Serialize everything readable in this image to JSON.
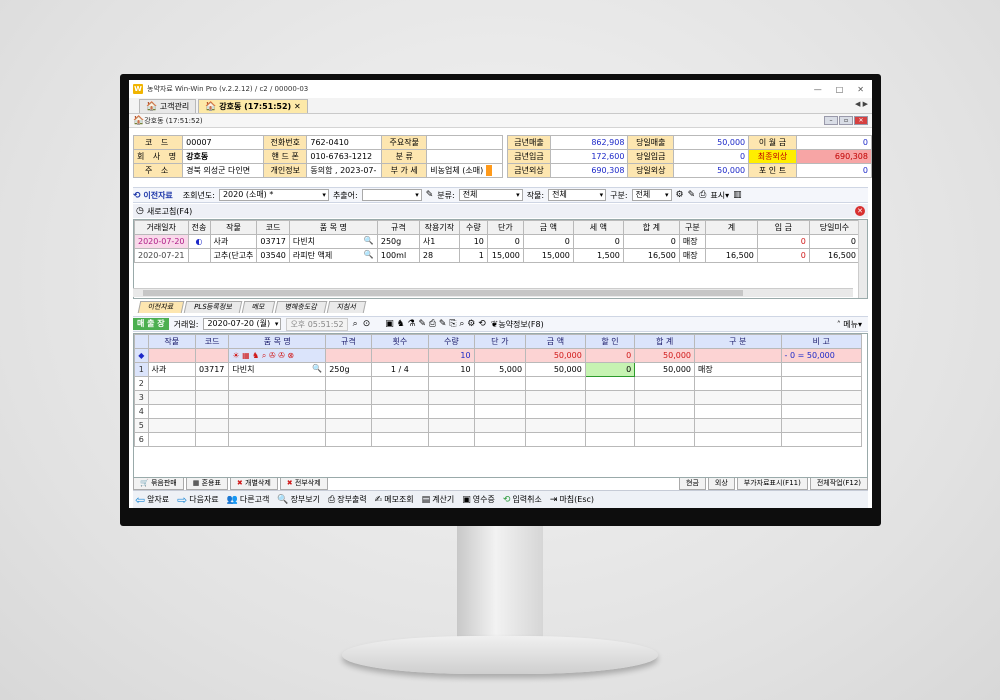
{
  "window": {
    "title": "농약자료 Win-Win Pro (v.2.2.12) / c2 / 00000-03",
    "logo": "W",
    "controls": [
      "—",
      "□",
      "✕"
    ]
  },
  "tabs": [
    {
      "label": "고객관리",
      "icon": "home-icon"
    },
    {
      "label": "강호동 (17:51:52)",
      "icon": "home-icon",
      "active": true
    }
  ],
  "subbar": {
    "title": "강호동 (17:51:52)"
  },
  "customer": {
    "rows": [
      [
        {
          "l": "코 드",
          "v": "00007"
        },
        {
          "l": "전화번호",
          "v": "762-0410"
        },
        {
          "l": "주요작물",
          "v": ""
        }
      ],
      [
        {
          "l": "회 사 명",
          "v": "강호동"
        },
        {
          "l": "핸 드 폰",
          "v": "010-6763-1212"
        },
        {
          "l": "분 류",
          "v": ""
        }
      ],
      [
        {
          "l": "주 소",
          "v": "경북 의성군 다인면"
        },
        {
          "l": "개인정보",
          "v": "동의함 , 2023-07-"
        },
        {
          "l": "부 가 세",
          "v": "비농업체 (소매)"
        }
      ]
    ]
  },
  "summary": {
    "rows": [
      [
        {
          "l": "금년매출",
          "v": "862,908"
        },
        {
          "l": "당일매출",
          "v": "50,000"
        },
        {
          "l": "이 월 금",
          "v": "0"
        }
      ],
      [
        {
          "l": "금년입금",
          "v": "172,600"
        },
        {
          "l": "당일입금",
          "v": "0"
        },
        {
          "l": "최종외상",
          "v": "690,308",
          "hot": true
        }
      ],
      [
        {
          "l": "금년외상",
          "v": "690,308"
        },
        {
          "l": "당일외상",
          "v": "50,000"
        },
        {
          "l": "포 인 트",
          "v": "0"
        }
      ]
    ]
  },
  "filter": {
    "prev_label": "이전자료",
    "year_label": "조회년도:",
    "year_value": "2020 (소매) *",
    "extract_label": "추출어:",
    "extract_value": "",
    "category_label": "분류:",
    "category_value": "전체",
    "crop_label": "작물:",
    "crop_value": "전체",
    "type_label": "구분:",
    "type_value": "전체",
    "display_label": "표시"
  },
  "refresh_label": "새로고침(F4)",
  "history": {
    "headers": [
      "거래일자",
      "전송",
      "작물",
      "코드",
      "품 목 명",
      "규격",
      "작용기작",
      "수량",
      "단가",
      "금 액",
      "세 액",
      "합 계",
      "구분",
      "계",
      "입 금",
      "당일미수"
    ],
    "rows": [
      [
        "2020-07-20",
        "◐",
        "사과",
        "03717",
        "다빈치",
        "250g",
        "사1",
        "10",
        "0",
        "0",
        "0",
        "0",
        "매장",
        "",
        "0",
        "0"
      ],
      [
        "2020-07-21",
        "",
        "고추(단고추",
        "03540",
        "라피탄 액제",
        "100ml",
        "28",
        "1",
        "15,000",
        "15,000",
        "1,500",
        "16,500",
        "매장",
        "16,500",
        "0",
        "16,500"
      ]
    ]
  },
  "lower_tabs": [
    "이전자료",
    "PLS등록정보",
    "메모",
    "병해충도감",
    "지침서"
  ],
  "sale": {
    "chip": "매 출 장",
    "date_label": "거래일:",
    "date_value": "2020-07-20 (월)",
    "time_value": "오후 05:51:52",
    "info_label": "농약정보(F8)",
    "menu_label": "메뉴"
  },
  "sale_grid": {
    "headers": [
      "",
      "작물",
      "코드",
      "품 목 명",
      "규격",
      "횟수",
      "수량",
      "단 가",
      "금 액",
      "할 인",
      "합 계",
      "구 분",
      "비 고"
    ],
    "sum_row": {
      "marker": "◆",
      "qty": "10",
      "amount": "50,000",
      "discount": "0",
      "total": "50,000",
      "note": "- 0 = 50,000"
    },
    "rows": [
      {
        "n": "1",
        "crop": "사과",
        "code": "03717",
        "name": "다빈치",
        "spec": "250g",
        "times": "1 / 4",
        "qty": "10",
        "price": "5,000",
        "amount": "50,000",
        "discount": "0",
        "total": "50,000",
        "kind": "매장",
        "note": ""
      },
      {
        "n": "2"
      },
      {
        "n": "3"
      },
      {
        "n": "4"
      },
      {
        "n": "5"
      },
      {
        "n": "6"
      }
    ]
  },
  "bottom_tabs": {
    "left": [
      "묶음판매",
      "혼용표",
      "개별삭제",
      "전부삭제"
    ],
    "right": [
      "현금",
      "외상",
      "부가자료표시(F11)",
      "전체작업(F12)"
    ]
  },
  "actions": [
    "앞자료",
    "다음자료",
    "다른고객",
    "장부보기",
    "장부출력",
    "메모조회",
    "계산기",
    "영수증",
    "입력취소",
    "마침(Esc)"
  ]
}
